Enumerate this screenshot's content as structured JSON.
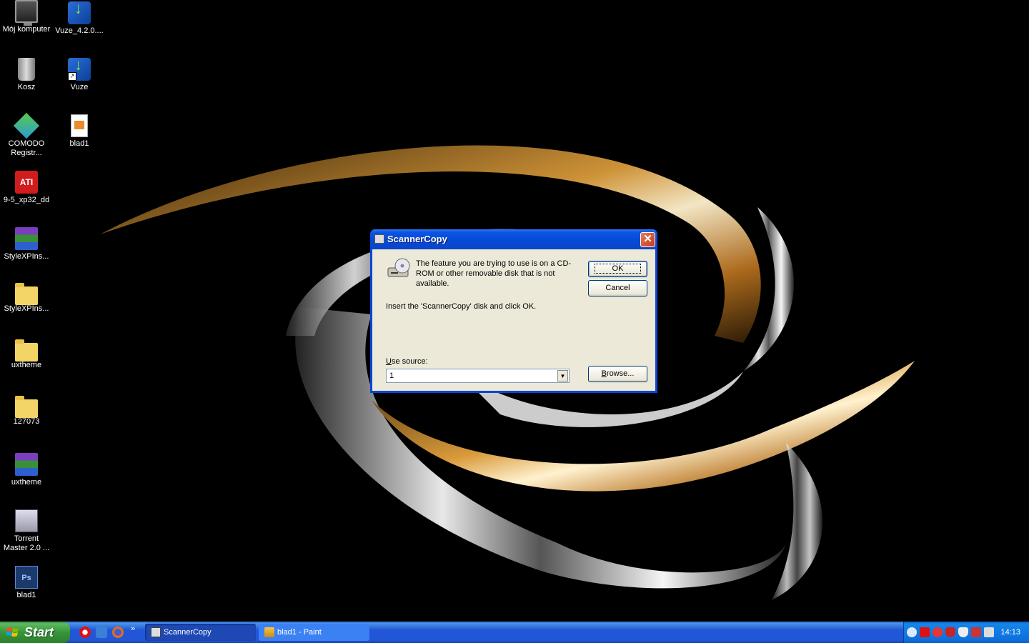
{
  "desktop": {
    "icons": [
      {
        "label": "Mój komputer",
        "icon": "computer-icon"
      },
      {
        "label": "Vuze_4.2.0....",
        "icon": "vuze-installer-icon"
      },
      {
        "label": "Kosz",
        "icon": "recycle-bin-icon"
      },
      {
        "label": "Vuze",
        "icon": "vuze-icon"
      },
      {
        "label": "COMODO Registr...",
        "icon": "comodo-icon"
      },
      {
        "label": "blad1",
        "icon": "image-file-icon"
      },
      {
        "label": "9-5_xp32_dd",
        "icon": "ati-icon"
      },
      {
        "label": "StyleXPIns...",
        "icon": "winrar-archive-icon"
      },
      {
        "label": "StyleXPIns...",
        "icon": "folder-icon"
      },
      {
        "label": "uxtheme",
        "icon": "folder-icon"
      },
      {
        "label": "127073",
        "icon": "folder-icon"
      },
      {
        "label": "uxtheme",
        "icon": "winrar-archive-icon"
      },
      {
        "label": "Torrent Master 2.0 ...",
        "icon": "torrent-master-icon"
      },
      {
        "label": "blad1",
        "icon": "photoshop-file-icon"
      }
    ]
  },
  "dialog": {
    "title": "ScannerCopy",
    "message": "The feature you are trying to use is on a CD-ROM or other removable disk that is not available.",
    "instruction": "Insert the 'ScannerCopy' disk and click OK.",
    "source_label_accel": "U",
    "source_label_rest": "se source:",
    "source_value": "1",
    "ok_label": "OK",
    "cancel_label": "Cancel",
    "browse_accel": "B",
    "browse_rest": "rowse..."
  },
  "taskbar": {
    "start_label": "Start",
    "tasks": [
      {
        "label": "ScannerCopy",
        "active": true
      },
      {
        "label": "blad1 - Paint",
        "active": false
      }
    ],
    "clock": "14:13"
  },
  "colors": {
    "titlebar": "#0b55e4",
    "dialog_face": "#ece9d8",
    "taskbar": "#2157d7",
    "start": "#36963a"
  }
}
